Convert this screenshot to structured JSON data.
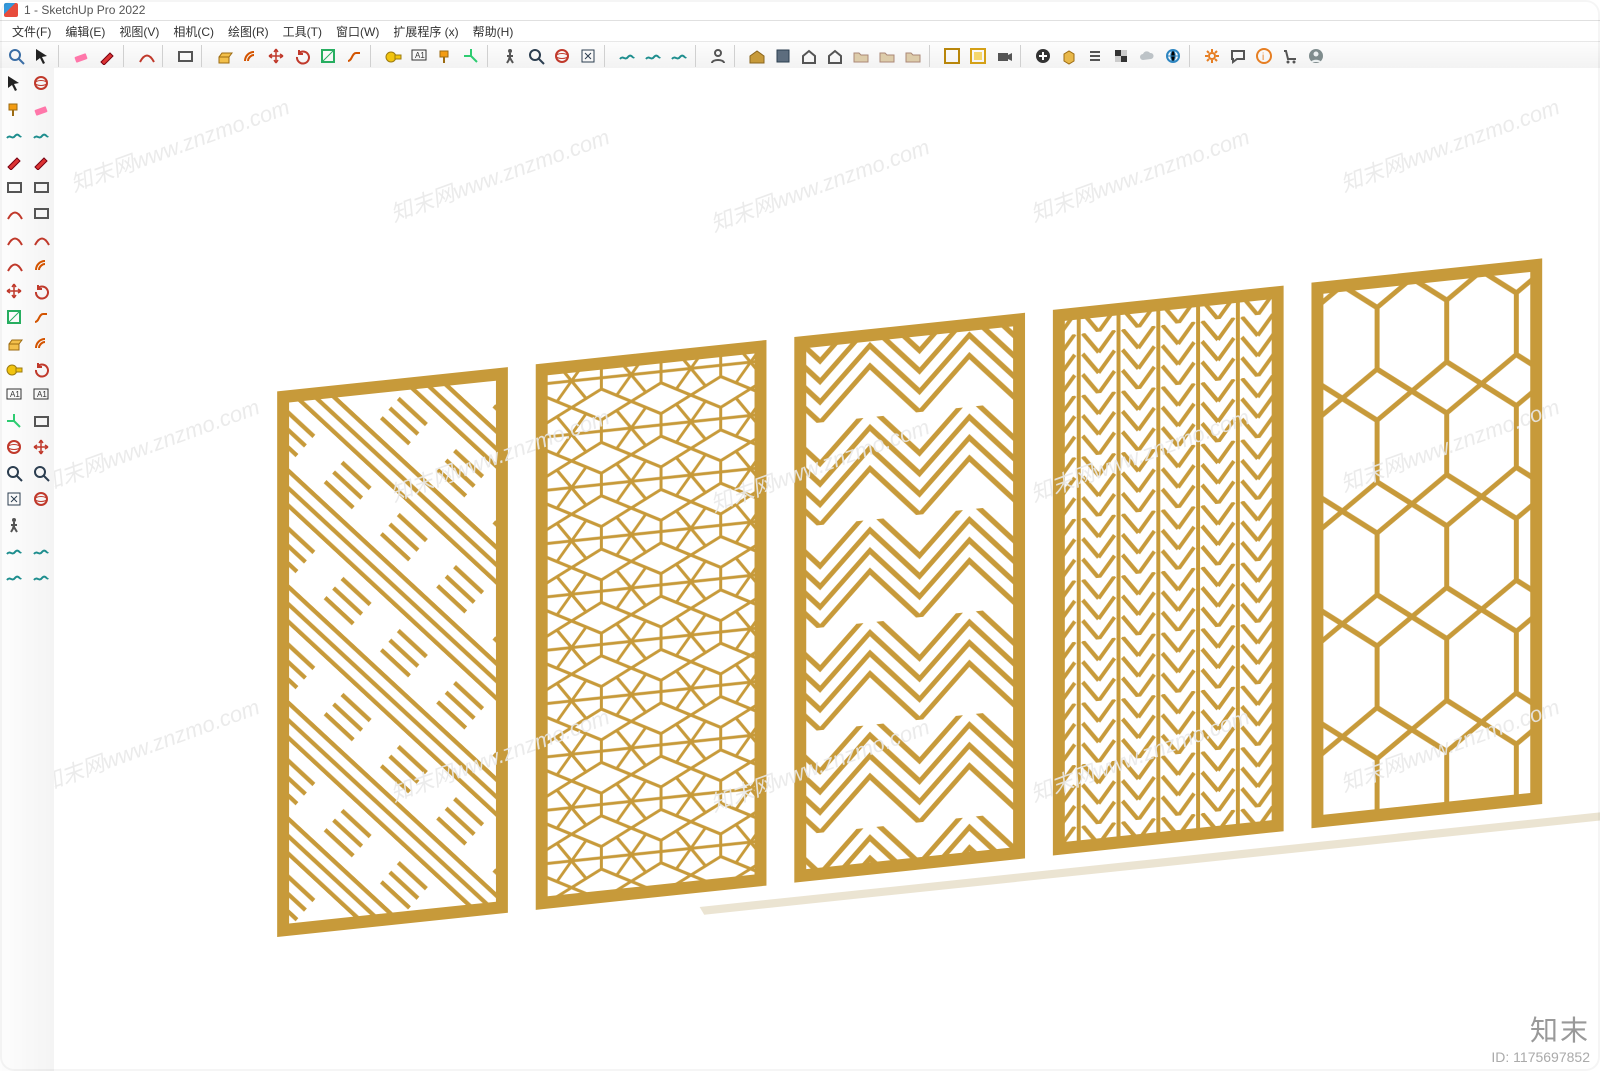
{
  "window": {
    "title": "1 - SketchUp Pro 2022"
  },
  "menu": {
    "items": [
      {
        "label": "文件(F)"
      },
      {
        "label": "编辑(E)"
      },
      {
        "label": "视图(V)"
      },
      {
        "label": "相机(C)"
      },
      {
        "label": "绘图(R)"
      },
      {
        "label": "工具(T)"
      },
      {
        "label": "窗口(W)"
      },
      {
        "label": "扩展程序 (x)"
      },
      {
        "label": "帮助(H)"
      }
    ]
  },
  "watermark": {
    "text": "知末网www.znzmo.com",
    "brand": "知末",
    "id_label": "ID: 1175697852"
  },
  "colors": {
    "panel": "#c79a3a"
  },
  "top_tools": [
    "search-icon",
    "select-arrow-icon",
    "sep",
    "eraser-icon",
    "pencil-icon",
    "sep",
    "arc-icon",
    "sep",
    "rectangle-icon",
    "sep",
    "pushpull-icon",
    "offset-icon",
    "move-icon",
    "rotate-icon",
    "scale-icon",
    "followme-icon",
    "sep",
    "tape-icon",
    "text-icon",
    "paint-icon",
    "axes-icon",
    "sep",
    "walk-icon",
    "zoom-icon",
    "orbit-icon",
    "zoom-extents-icon",
    "sep",
    "sandbox-icon",
    "sandbox-drape-icon",
    "sandbox-stamp-icon",
    "sep",
    "user-icon",
    "sep",
    "warehouse-icon",
    "component-icon",
    "house-icon",
    "house-open-icon",
    "folder-icon",
    "folder-open-icon",
    "folder-box-icon",
    "sep",
    "outliner-icon",
    "bbox-icon",
    "camera-icon",
    "sep",
    "add-icon",
    "cube-icon",
    "list-icon",
    "checker-icon",
    "cloud-icon",
    "globe-icon",
    "sep",
    "gear-icon",
    "chat-icon",
    "info-icon",
    "cart-icon",
    "avatar-icon"
  ],
  "left_tools": [
    [
      "select-arrow-icon",
      "orbit-eye-icon"
    ],
    [
      "paint-icon",
      "eraser-icon"
    ],
    [
      "spiral-icon",
      "drape-icon"
    ],
    [
      "pencil-icon",
      "freehand-icon"
    ],
    [
      "rectangle-icon",
      "rectangle-rot-icon"
    ],
    [
      "circle-icon",
      "polygon-icon"
    ],
    [
      "arc-icon",
      "arc-2pt-icon"
    ],
    [
      "arc-pie-icon",
      "offset-icon"
    ],
    [
      "move-icon",
      "rotate-icon"
    ],
    [
      "scale-icon",
      "followme-icon"
    ],
    [
      "pushpull-icon",
      "offset2-icon"
    ],
    [
      "tape-icon",
      "protractor-icon"
    ],
    [
      "dimension-icon",
      "text-icon"
    ],
    [
      "axes-icon",
      "section-icon"
    ],
    [
      "orbit-icon",
      "pan-icon"
    ],
    [
      "zoom-icon",
      "zoom-window-icon"
    ],
    [
      "zoom-extents-icon",
      "eye-icon"
    ],
    [
      "footprints-icon",
      ""
    ],
    [
      "sandbox-icon",
      "sandbox2-icon"
    ],
    [
      "sandbox3-icon",
      "sandbox4-icon"
    ]
  ],
  "viewport": {
    "panels": [
      {
        "pattern": "woven-diagonal"
      },
      {
        "pattern": "hexagon-stripes"
      },
      {
        "pattern": "concentric-chevrons"
      },
      {
        "pattern": "herringbone-columns"
      },
      {
        "pattern": "elongated-hexagons"
      }
    ]
  }
}
